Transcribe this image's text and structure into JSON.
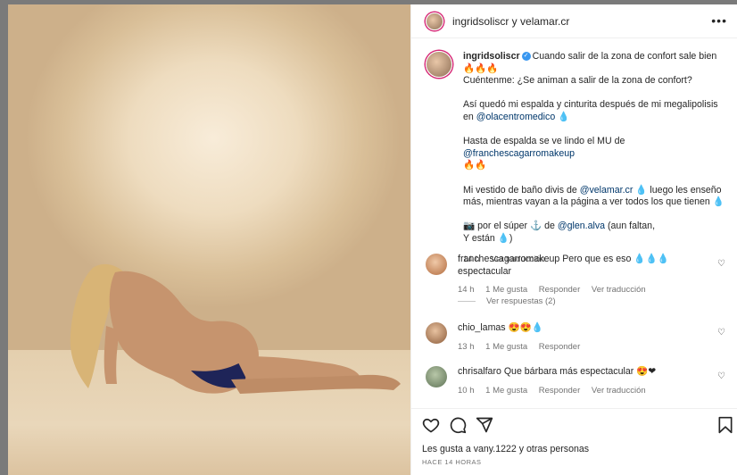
{
  "header": {
    "title": "ingridsoliscr y velamar.cr"
  },
  "caption": {
    "username": "ingridsoliscr",
    "line1": "Cuando salir de la zona de confort sale bien ",
    "emoji1": "🔥🔥🔥",
    "line2": "Cuéntenme: ¿Se animan a salir de la zona de confort?",
    "p2_text": "Así quedó mi espalda y cinturita después de mi megalipolisis en ",
    "p2_mention": "@olacentromedico",
    "p2_drop": " 💧",
    "p3_text": "Hasta de espalda se ve lindo el MU de ",
    "p3_mention": "@franchescagarromakeup",
    "p3_emoji": "🔥🔥",
    "p4_text": "Mi vestido de baño divis de ",
    "p4_mention": "@velamar.cr",
    "p4_rest": " 💧 luego les enseño más, mientras vayan a la página a ver todos los que tienen 💧",
    "p5_text": "📷 por el súper ⚓ de ",
    "p5_mention": "@glen.alva",
    "p5_rest": " (aun faltan,",
    "p5_line2": "Y están 💧)",
    "time": "14 h",
    "translate": "Ver traducción"
  },
  "comments": [
    {
      "username": "franchescagarromakeup",
      "text": " Pero que es eso 💧💧💧 espectacular",
      "time": "14 h",
      "likes": "1 Me gusta",
      "reply": "Responder",
      "translate": "Ver traducción"
    },
    {
      "username": "chio_lamas",
      "text": " 😍😍💧",
      "time": "13 h",
      "likes": "1 Me gusta",
      "reply": "Responder"
    },
    {
      "username": "chrisalfaro",
      "text": " Que bárbara más espectacular 😍❤",
      "time": "10 h",
      "likes": "1 Me gusta",
      "reply": "Responder",
      "translate": "Ver traducción"
    }
  ],
  "replies": "Ver respuestas (2)",
  "footer": {
    "likes": "Les gusta a vany.1222 y otras personas",
    "time": "HACE 14 HORAS"
  },
  "icons": [
    "heart-icon",
    "comment-icon",
    "share-icon",
    "bookmark-icon",
    "more-icon",
    "verified-icon"
  ],
  "colors": {
    "mention": "#00376b",
    "verified": "#3897f0",
    "muted": "#737373"
  }
}
